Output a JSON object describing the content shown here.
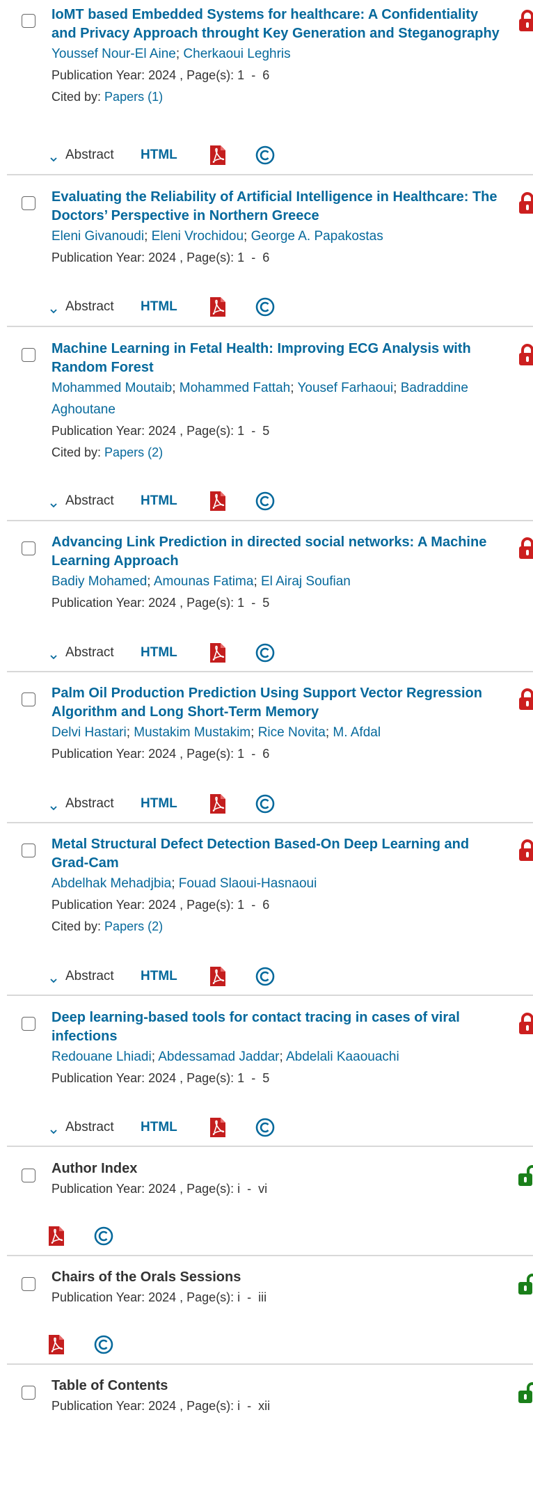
{
  "items": [
    {
      "title": "IoMT based Embedded Systems for healthcare: A Confidentiality and Privacy Approach throught Key Generation and Steganography",
      "authors": [
        "Youssef Nour-El Aine",
        "Cherkaoui Leghris"
      ],
      "meta": "Publication Year: 2024 , Page(s): 1  -  6",
      "cited_prefix": "Cited by: ",
      "cited_link": "Papers (1)",
      "abstract_label": "Abstract",
      "html_label": "HTML",
      "access": "locked"
    },
    {
      "title": "Evaluating the Reliability of Artificial Intelligence in Healthcare: The Doctors’ Perspective in Northern Greece",
      "authors": [
        "Eleni Givanoudi",
        "Eleni Vrochidou",
        "George A. Papakostas"
      ],
      "meta": "Publication Year: 2024 , Page(s): 1  -  6",
      "abstract_label": "Abstract",
      "html_label": "HTML",
      "access": "locked"
    },
    {
      "title": "Machine Learning in Fetal Health: Improving ECG Analysis with Random Forest",
      "authors": [
        "Mohammed Moutaib",
        "Mohammed Fattah",
        "Yousef Farhaoui",
        "Badraddine Aghoutane"
      ],
      "meta": "Publication Year: 2024 , Page(s): 1  -  5",
      "cited_prefix": "Cited by: ",
      "cited_link": "Papers (2)",
      "abstract_label": "Abstract",
      "html_label": "HTML",
      "access": "locked"
    },
    {
      "title": "Advancing Link Prediction in directed social networks: A Machine Learning Approach",
      "authors": [
        "Badiy Mohamed",
        "Amounas Fatima",
        "El Airaj Soufian"
      ],
      "meta": "Publication Year: 2024 , Page(s): 1  -  5",
      "abstract_label": "Abstract",
      "html_label": "HTML",
      "access": "locked"
    },
    {
      "title": "Palm Oil Production Prediction Using Support Vector Regression Algorithm and Long Short-Term Memory",
      "authors": [
        "Delvi Hastari",
        "Mustakim Mustakim",
        "Rice Novita",
        "M. Afdal"
      ],
      "meta": "Publication Year: 2024 , Page(s): 1  -  6",
      "abstract_label": "Abstract",
      "html_label": "HTML",
      "access": "locked"
    },
    {
      "title": "Metal Structural Defect Detection Based-On Deep Learning and Grad-Cam",
      "authors": [
        "Abdelhak Mehadjbia",
        "Fouad Slaoui-Hasnaoui"
      ],
      "meta": "Publication Year: 2024 , Page(s): 1  -  6",
      "cited_prefix": "Cited by: ",
      "cited_link": "Papers (2)",
      "abstract_label": "Abstract",
      "html_label": "HTML",
      "access": "locked"
    },
    {
      "title": "Deep learning-based tools for contact tracing in cases of viral infections",
      "authors": [
        "Redouane Lhiadi",
        "Abdessamad Jaddar",
        "Abdelali Kaaouachi"
      ],
      "meta": "Publication Year: 2024 , Page(s): 1  -  5",
      "abstract_label": "Abstract",
      "html_label": "HTML",
      "access": "locked"
    },
    {
      "title": "Author Index",
      "authors": [],
      "meta": "Publication Year: 2024 , Page(s): i  -  vi",
      "access": "open"
    },
    {
      "title": "Chairs of the Orals Sessions",
      "authors": [],
      "meta": "Publication Year: 2024 , Page(s): i  -  iii",
      "access": "open"
    },
    {
      "title": "Table of Contents",
      "authors": [],
      "meta": "Publication Year: 2024 , Page(s): i  -  xii",
      "access": "open"
    }
  ],
  "colors": {
    "link": "#06699c",
    "lock_red": "#cc1f1f",
    "lock_green": "#1a7f1a",
    "pdf_red": "#c41e1e",
    "divider": "#d8d8d8"
  }
}
